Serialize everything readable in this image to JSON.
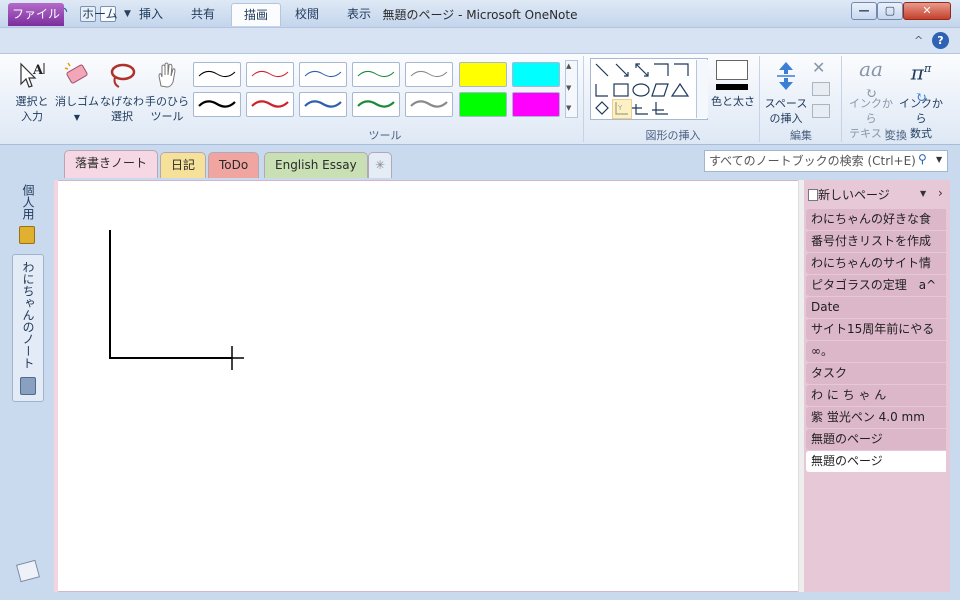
{
  "window": {
    "title": "無題のページ - Microsoft OneNote"
  },
  "qat": {
    "app_letter": "N"
  },
  "tabs": {
    "file": "ファイル",
    "home": "ホーム",
    "insert": "挿入",
    "share": "共有",
    "draw": "描画",
    "review": "校閲",
    "view": "表示"
  },
  "ribbon": {
    "select_line1": "選択と",
    "select_line2": "入力",
    "eraser": "消しゴム",
    "lasso_line1": "なげなわ",
    "lasso_line2": "選択",
    "pan_line1": "手のひら",
    "pan_line2": "ツール",
    "group_tools": "ツール",
    "group_shapes": "図形の挿入",
    "color_width": "色と太さ",
    "space_line1": "スペース",
    "space_line2": "の挿入",
    "group_edit": "編集",
    "ink_text_line1": "インクから",
    "ink_text_line2": "テキスト",
    "ink_math_line1": "インクから",
    "ink_math_line2": "数式",
    "group_convert": "変換",
    "pen_colors": [
      "#000000",
      "#d0202a",
      "#2e5fae",
      "#1a8a3a",
      "#8a8a8a"
    ],
    "highlighter_colors": [
      "#ffff00",
      "#00ffff",
      "#00ff00",
      "#ff00ff"
    ]
  },
  "sections": [
    {
      "label": "落書きノート",
      "color": "#f5d8e3"
    },
    {
      "label": "日記",
      "color": "#f6e19a"
    },
    {
      "label": "ToDo",
      "color": "#f0a5a0"
    },
    {
      "label": "English Essay",
      "color": "#c8e0b4"
    }
  ],
  "search": {
    "placeholder": "すべてのノートブックの検索 (Ctrl+E)"
  },
  "notebooks": {
    "personal": "個人用",
    "wani": "わにちゃんのノート"
  },
  "pagelist": {
    "new_page": "新しいページ",
    "pages": [
      "わにちゃんの好きな食",
      "番号付きリストを作成",
      "わにちゃんのサイト情",
      "ピタゴラスの定理　a^",
      "Date",
      "サイト15周年前にやる",
      "∞。",
      "タスク",
      "わ に ち ゃ ん",
      "紫 蛍光ペン 4.0 mm",
      "無題のページ",
      "無題のページ"
    ]
  }
}
